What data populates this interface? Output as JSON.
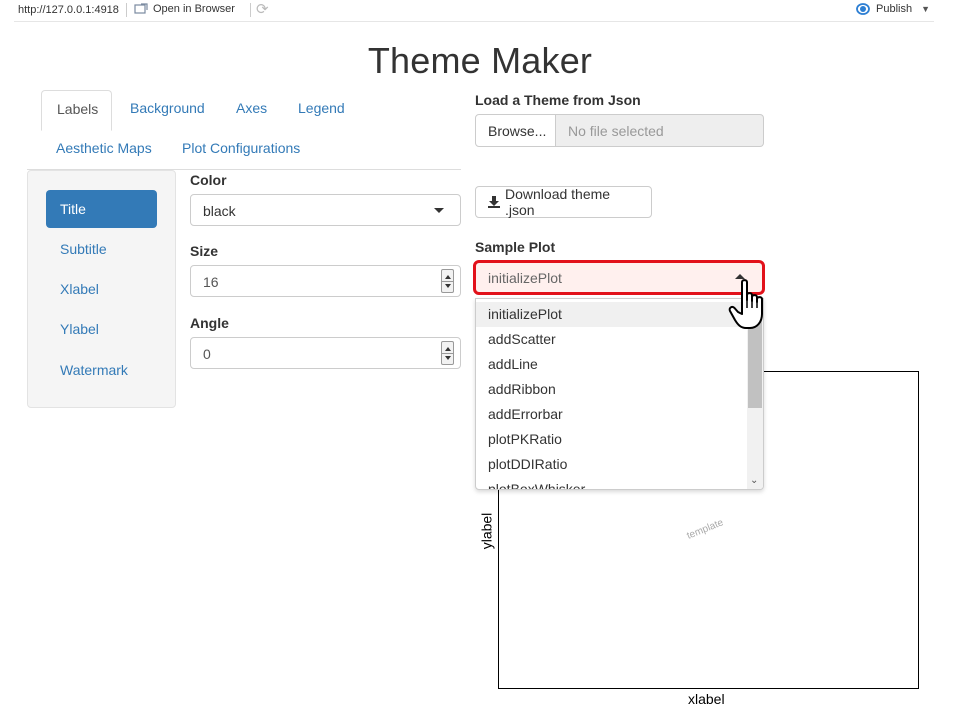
{
  "topbar": {
    "url": "http://127.0.0.1:4918",
    "open_in_browser": "Open in Browser",
    "publish": "Publish"
  },
  "page_title": "Theme Maker",
  "tabs": [
    {
      "label": "Labels",
      "active": true
    },
    {
      "label": "Background",
      "active": false
    },
    {
      "label": "Axes",
      "active": false
    },
    {
      "label": "Legend",
      "active": false
    },
    {
      "label": "Aesthetic Maps",
      "active": false
    },
    {
      "label": "Plot Configurations",
      "active": false
    }
  ],
  "pills": [
    {
      "label": "Title",
      "active": true
    },
    {
      "label": "Subtitle",
      "active": false
    },
    {
      "label": "Xlabel",
      "active": false
    },
    {
      "label": "Ylabel",
      "active": false
    },
    {
      "label": "Watermark",
      "active": false
    }
  ],
  "form": {
    "color_label": "Color",
    "color_value": "black",
    "size_label": "Size",
    "size_value": "16",
    "angle_label": "Angle",
    "angle_value": "0"
  },
  "load_theme": {
    "label": "Load a Theme from Json",
    "browse": "Browse...",
    "file_placeholder": "No file selected"
  },
  "download_button": "Download theme .json",
  "sample_plot": {
    "label": "Sample Plot",
    "selected": "initializePlot",
    "options": [
      "initializePlot",
      "addScatter",
      "addLine",
      "addRibbon",
      "addErrorbar",
      "plotPKRatio",
      "plotDDIRatio",
      "plotBoxWhisker"
    ]
  },
  "plot": {
    "xlabel": "xlabel",
    "ylabel": "ylabel",
    "watermark": "template"
  },
  "colors": {
    "link": "#337ab7",
    "active_pill": "#337ab7",
    "highlight_border": "#e2111a",
    "highlight_fill": "#fff0ee"
  }
}
